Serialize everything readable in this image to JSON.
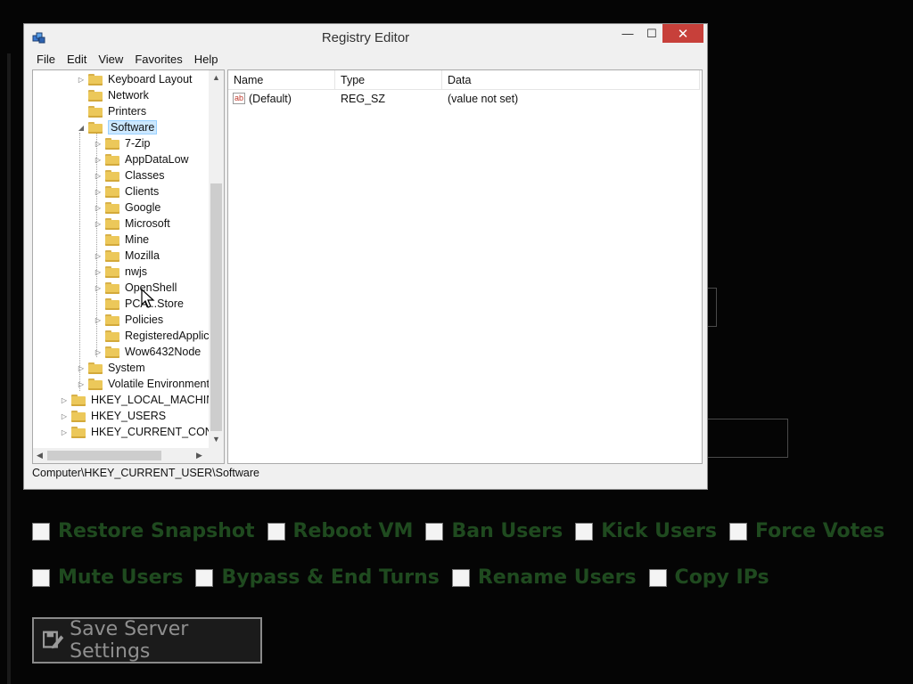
{
  "background": {
    "permissions_row1": [
      "Restore Snapshot",
      "Reboot VM",
      "Ban Users",
      "Kick Users",
      "Force Votes"
    ],
    "permissions_row2": [
      "Mute Users",
      "Bypass & End Turns",
      "Rename Users",
      "Copy IPs"
    ],
    "save_button": "Save Server Settings"
  },
  "window": {
    "title": "Registry Editor",
    "controls": {
      "minimize": "—",
      "maximize": "☐",
      "close": "✕"
    },
    "menu": [
      "File",
      "Edit",
      "View",
      "Favorites",
      "Help"
    ],
    "tree": [
      {
        "label": "Keyboard Layout",
        "level": 2,
        "arrow": "▷"
      },
      {
        "label": "Network",
        "level": 2,
        "arrow": ""
      },
      {
        "label": "Printers",
        "level": 2,
        "arrow": ""
      },
      {
        "label": "Software",
        "level": 2,
        "arrow": "◢",
        "selected": true
      },
      {
        "label": "7-Zip",
        "level": 3,
        "arrow": "▷"
      },
      {
        "label": "AppDataLow",
        "level": 3,
        "arrow": "▷"
      },
      {
        "label": "Classes",
        "level": 3,
        "arrow": "▷"
      },
      {
        "label": "Clients",
        "level": 3,
        "arrow": "▷"
      },
      {
        "label": "Google",
        "level": 3,
        "arrow": "▷"
      },
      {
        "label": "Microsoft",
        "level": 3,
        "arrow": "▷"
      },
      {
        "label": "Mine",
        "level": 3,
        "arrow": ""
      },
      {
        "label": "Mozilla",
        "level": 3,
        "arrow": "▷"
      },
      {
        "label": "nwjs",
        "level": 3,
        "arrow": "▷"
      },
      {
        "label": "OpenShell",
        "level": 3,
        "arrow": "▷"
      },
      {
        "label": "PCA...Store",
        "level": 3,
        "arrow": ""
      },
      {
        "label": "Policies",
        "level": 3,
        "arrow": "▷"
      },
      {
        "label": "RegisteredApplica",
        "level": 3,
        "arrow": ""
      },
      {
        "label": "Wow6432Node",
        "level": 3,
        "arrow": "▷"
      },
      {
        "label": "System",
        "level": 2,
        "arrow": "▷"
      },
      {
        "label": "Volatile Environment",
        "level": 2,
        "arrow": "▷"
      },
      {
        "label": "HKEY_LOCAL_MACHINE",
        "level": 1,
        "arrow": "▷"
      },
      {
        "label": "HKEY_USERS",
        "level": 1,
        "arrow": "▷"
      },
      {
        "label": "HKEY_CURRENT_CONFIG",
        "level": 1,
        "arrow": "▷"
      }
    ],
    "columns": [
      "Name",
      "Type",
      "Data"
    ],
    "values": [
      {
        "name": "(Default)",
        "type": "REG_SZ",
        "data": "(value not set)",
        "icon": "ab"
      }
    ],
    "status": "Computer\\HKEY_CURRENT_USER\\Software"
  }
}
